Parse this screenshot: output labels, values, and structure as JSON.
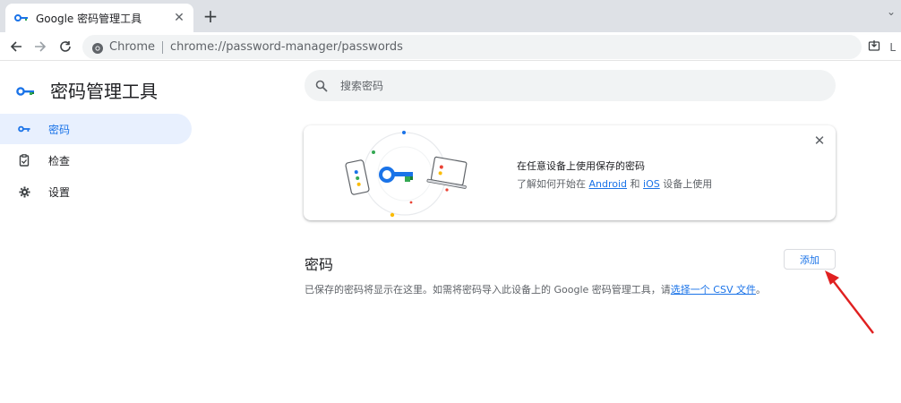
{
  "browser": {
    "tab": {
      "title": "Google 密码管理工具",
      "close_symbol": "✕"
    },
    "new_tab_symbol": "+",
    "omnibox": {
      "chip_label": "Chrome",
      "url": "chrome://password-manager/passwords"
    },
    "tabstrip_right_symbol": "⌄",
    "toolbar_right_text": "L"
  },
  "app": {
    "title": "密码管理工具",
    "nav": [
      {
        "label": "密码",
        "icon": "key-icon",
        "active": true
      },
      {
        "label": "检查",
        "icon": "checkup-icon",
        "active": false
      },
      {
        "label": "设置",
        "icon": "gear-icon",
        "active": false
      }
    ]
  },
  "search": {
    "placeholder": "搜索密码"
  },
  "promo": {
    "title": "在任意设备上使用保存的密码",
    "body_prefix": "了解如何开始在 ",
    "android_link": "Android",
    "body_and": " 和 ",
    "ios_link": "iOS",
    "body_suffix": " 设备上使用",
    "close_symbol": "✕"
  },
  "passwords_section": {
    "title": "密码",
    "add_label": "添加",
    "desc_prefix": "已保存的密码将显示在这里。如需将密码导入此设备上的 Google 密码管理工具，请",
    "desc_link": "选择一个 CSV 文件",
    "desc_suffix": "。"
  },
  "colors": {
    "accent": "#1a73e8",
    "active_nav_bg": "#e8f0fe",
    "annotation": "#e02020"
  }
}
